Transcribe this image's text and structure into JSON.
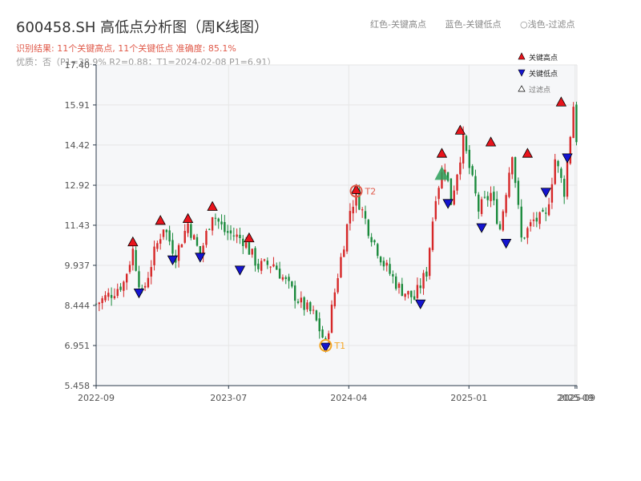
{
  "header": {
    "title": "600458.SH 高低点分析图（周K线图）",
    "result_line": "识别结果: 11个关键高点, 11个关键低点   准确度: 85.1%",
    "quality_line": "优质：否（P1=38.9%  R2=0.88；T1=2024-02-08 P1=6.91）"
  },
  "top_legend": {
    "red": "红色-关键高点",
    "blue": "蓝色-关键低点",
    "light": "○浅色-过滤点"
  },
  "colors": {
    "up": "#d62728",
    "down": "#1a8a3c",
    "high_marker": "#e8141c",
    "low_marker": "#1414d0",
    "filtered": "#2ca05a",
    "grid": "#e6e6e6",
    "plot_bg": "#f6f7f9",
    "axis": "#2b3a4a",
    "t1": "#f5a623",
    "t2": "#e05a4a"
  },
  "chart_data": {
    "type": "candlestick",
    "title": "600458.SH 高低点分析图（周K线图）",
    "ylim": [
      5.458,
      17.4
    ],
    "yticks": [
      "17.40",
      "15.91",
      "14.42",
      "12.92",
      "11.43",
      "9.937",
      "8.444",
      "6.951",
      "5.458"
    ],
    "ytick_values": [
      17.4,
      15.91,
      14.42,
      12.92,
      11.43,
      9.937,
      8.444,
      6.951,
      5.458
    ],
    "x_start": "2022-09-01",
    "x_end": "2025-09-05",
    "xticks": [
      {
        "date": "2022-09-01",
        "label": "2022-09"
      },
      {
        "date": "2023-07-01",
        "label": "2023-07"
      },
      {
        "date": "2024-04-01",
        "label": "2024-04"
      },
      {
        "date": "2025-01-01",
        "label": "2025-01"
      },
      {
        "date": "2025-09-01",
        "label": "2025-09"
      },
      {
        "date": "2025-09-05",
        "label": "2025-09"
      }
    ],
    "grid": true,
    "path": [
      [
        "2022-09-01",
        8.5
      ],
      [
        "2022-10-06",
        8.9
      ],
      [
        "2022-11-03",
        9.3
      ],
      [
        "2022-11-24",
        10.5
      ],
      [
        "2022-12-15",
        8.8
      ],
      [
        "2023-01-12",
        10.4
      ],
      [
        "2023-02-02",
        11.4
      ],
      [
        "2023-03-02",
        10.3
      ],
      [
        "2023-03-30",
        11.5
      ],
      [
        "2023-04-27",
        10.3
      ],
      [
        "2023-05-25",
        11.9
      ],
      [
        "2023-06-22",
        11.2
      ],
      [
        "2023-08-03",
        10.9
      ],
      [
        "2023-09-07",
        9.9
      ],
      [
        "2023-10-12",
        10.0
      ],
      [
        "2023-11-09",
        9.3
      ],
      [
        "2023-12-14",
        8.5
      ],
      [
        "2024-01-11",
        8.1
      ],
      [
        "2024-02-08",
        7.0
      ],
      [
        "2024-03-07",
        9.6
      ],
      [
        "2024-04-04",
        12.0
      ],
      [
        "2024-04-18",
        12.6
      ],
      [
        "2024-05-16",
        11.3
      ],
      [
        "2024-06-20",
        10.0
      ],
      [
        "2024-07-25",
        9.1
      ],
      [
        "2024-08-29",
        8.7
      ],
      [
        "2024-09-26",
        9.7
      ],
      [
        "2024-10-17",
        12.6
      ],
      [
        "2024-11-07",
        13.7
      ],
      [
        "2024-11-21",
        12.3
      ],
      [
        "2024-12-19",
        14.6
      ],
      [
        "2025-01-23",
        12.0
      ],
      [
        "2025-02-20",
        12.6
      ],
      [
        "2025-03-13",
        11.3
      ],
      [
        "2025-04-10",
        14.2
      ],
      [
        "2025-05-01",
        10.9
      ],
      [
        "2025-05-29",
        11.6
      ],
      [
        "2025-06-26",
        11.7
      ],
      [
        "2025-07-17",
        13.9
      ],
      [
        "2025-08-07",
        12.7
      ],
      [
        "2025-08-28",
        15.9
      ],
      [
        "2025-09-05",
        14.5
      ]
    ],
    "key_highs": [
      {
        "date": "2022-11-24",
        "value": 10.75
      },
      {
        "date": "2023-01-26",
        "value": 11.55
      },
      {
        "date": "2023-03-30",
        "value": 11.62
      },
      {
        "date": "2023-05-25",
        "value": 12.07
      },
      {
        "date": "2023-08-17",
        "value": 10.9
      },
      {
        "date": "2024-10-31",
        "value": 14.05
      },
      {
        "date": "2024-12-12",
        "value": 14.91
      },
      {
        "date": "2025-02-20",
        "value": 14.47
      },
      {
        "date": "2025-05-15",
        "value": 14.05
      },
      {
        "date": "2025-07-31",
        "value": 15.96
      },
      {
        "date": "2024-04-18",
        "value": 12.7
      }
    ],
    "key_lows": [
      {
        "date": "2022-12-08",
        "value": 8.97
      },
      {
        "date": "2023-02-23",
        "value": 10.2
      },
      {
        "date": "2023-04-27",
        "value": 10.3
      },
      {
        "date": "2023-07-27",
        "value": 9.82
      },
      {
        "date": "2024-02-08",
        "value": 6.95
      },
      {
        "date": "2024-09-12",
        "value": 8.56
      },
      {
        "date": "2024-11-14",
        "value": 12.3
      },
      {
        "date": "2025-01-30",
        "value": 11.4
      },
      {
        "date": "2025-03-27",
        "value": 10.82
      },
      {
        "date": "2025-06-26",
        "value": 12.72
      },
      {
        "date": "2025-08-14",
        "value": 14.0
      }
    ],
    "filtered_points": [
      {
        "date": "2024-10-31",
        "value": 13.3,
        "marker": "high"
      }
    ],
    "annotations": [
      {
        "label": "T1",
        "date": "2024-02-08",
        "value": 6.95
      },
      {
        "label": "T2",
        "date": "2024-04-18",
        "value": 12.7
      }
    ],
    "legend": {
      "position": "top-right",
      "entries": [
        "关键高点",
        "关键低点",
        "过滤点"
      ]
    }
  }
}
